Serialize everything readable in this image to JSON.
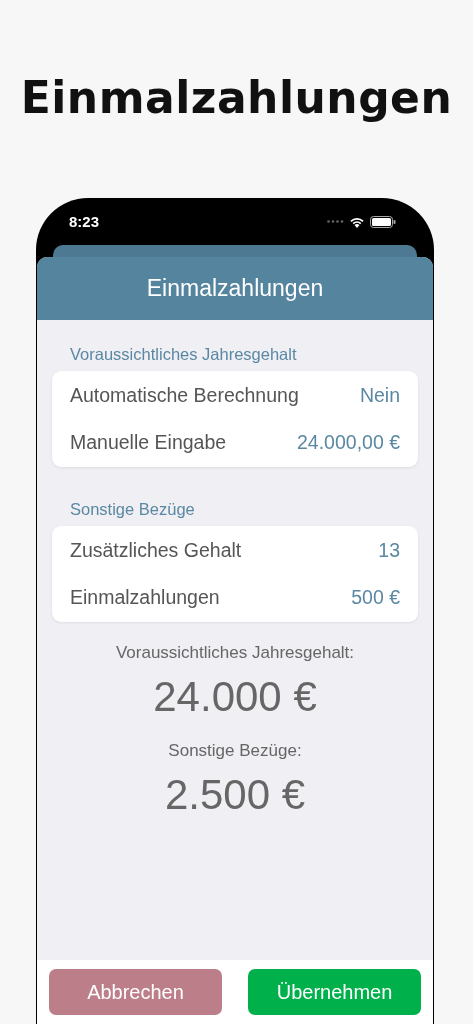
{
  "headline": "Einmalzahlungen",
  "status_bar": {
    "time": "8:23"
  },
  "sheet": {
    "title": "Einmalzahlungen"
  },
  "sections": [
    {
      "header": "Voraussichtliches Jahresgehalt",
      "rows": [
        {
          "label": "Automatische Berechnung",
          "value": "Nein"
        },
        {
          "label": "Manuelle Eingabe",
          "value": "24.000,00 €"
        }
      ]
    },
    {
      "header": "Sonstige Bezüge",
      "rows": [
        {
          "label": "Zusätzliches Gehalt",
          "value": "13"
        },
        {
          "label": "Einmalzahlungen",
          "value": "500 €"
        }
      ]
    }
  ],
  "summary": [
    {
      "label": "Voraussichtliches Jahresgehalt:",
      "amount": "24.000 €"
    },
    {
      "label": "Sonstige Bezüge:",
      "amount": "2.500 €"
    }
  ],
  "buttons": [
    {
      "label": "Abbrechen",
      "kind": "cancel"
    },
    {
      "label": "Übernehmen",
      "kind": "confirm"
    }
  ]
}
